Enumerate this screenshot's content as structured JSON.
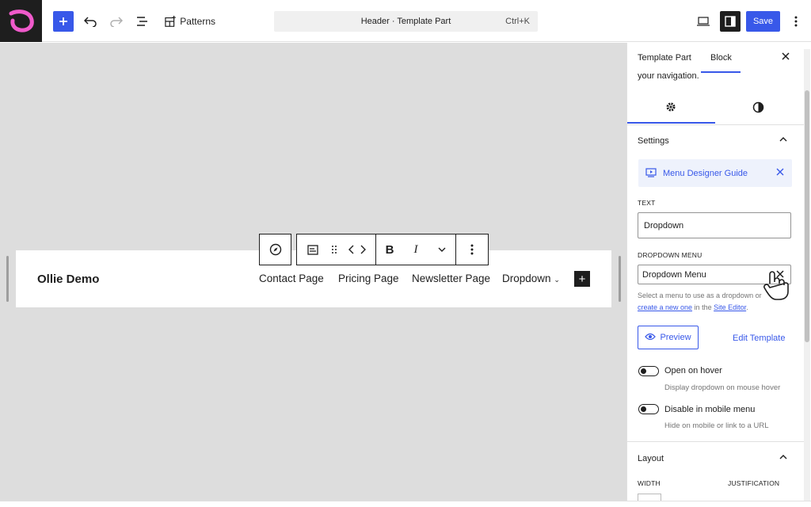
{
  "topbar": {
    "patterns_label": "Patterns",
    "command_title": "Header · Template Part",
    "command_shortcut": "Ctrl+K",
    "save_label": "Save"
  },
  "canvas": {
    "site_title": "Ollie Demo",
    "nav": [
      "Contact Page",
      "Pricing Page",
      "Newsletter Page",
      "Dropdown"
    ]
  },
  "sidebar": {
    "tabs": [
      "Template Part",
      "Block"
    ],
    "cut_text": "your navigation.",
    "settings_title": "Settings",
    "guide_label": "Menu Designer Guide",
    "text_label": "TEXT",
    "text_value": "Dropdown",
    "dropdown_label": "DROPDOWN MENU",
    "dropdown_value": "Dropdown Menu",
    "help_prefix": "Select a menu to use as a dropdown or",
    "help_link1": "create a new one",
    "help_mid": "in the",
    "help_link2": "Site Editor",
    "help_end": ".",
    "preview_label": "Preview",
    "edit_template_label": "Edit Template",
    "toggle1_label": "Open on hover",
    "toggle1_help": "Display dropdown on mouse hover",
    "toggle2_label": "Disable in mobile menu",
    "toggle2_help": "Hide on mobile or link to a URL",
    "layout_title": "Layout",
    "width_label": "WIDTH",
    "justification_label": "JUSTIFICATION"
  }
}
